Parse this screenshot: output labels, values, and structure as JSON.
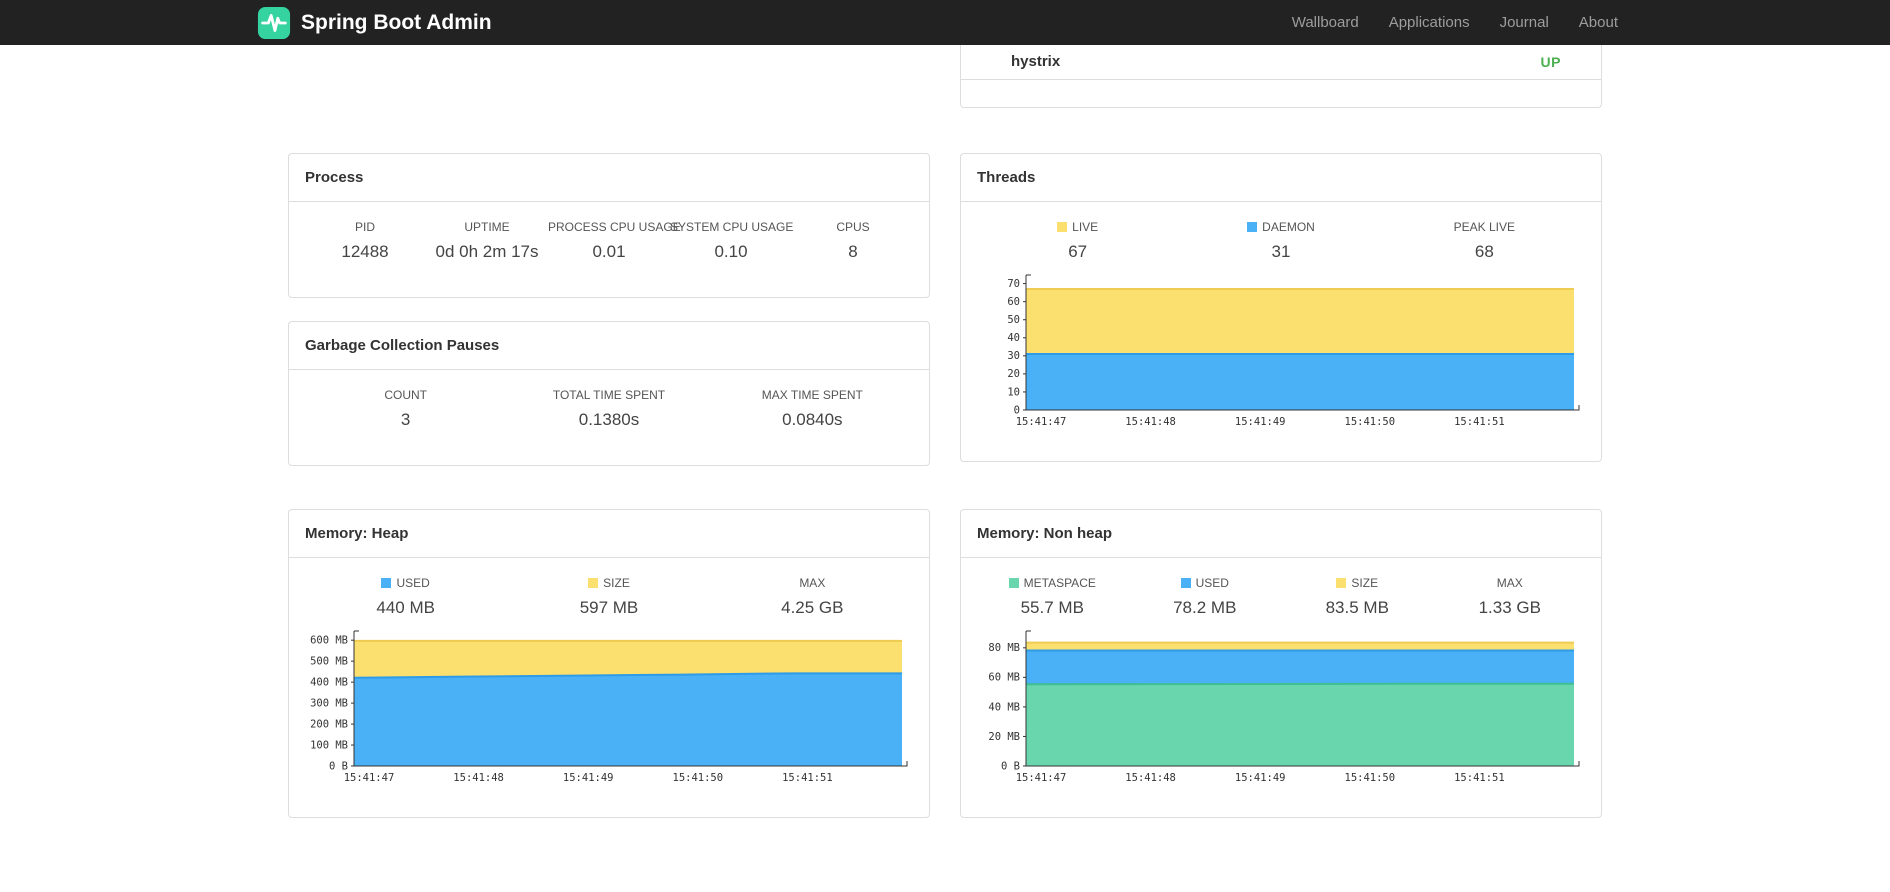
{
  "navbar": {
    "brand": "Spring Boot Admin",
    "links": [
      "Wallboard",
      "Applications",
      "Journal",
      "About"
    ]
  },
  "status_panel": {
    "application": "hystrix",
    "status": "UP",
    "status_color": "#4CAF50"
  },
  "panels": {
    "process": {
      "title": "Process",
      "metrics": [
        {
          "label": "PID",
          "value": "12488"
        },
        {
          "label": "UPTIME",
          "value": "0d 0h 2m 17s"
        },
        {
          "label": "PROCESS CPU USAGE",
          "value": "0.01"
        },
        {
          "label": "SYSTEM CPU USAGE",
          "value": "0.10"
        },
        {
          "label": "CPUS",
          "value": "8"
        }
      ]
    },
    "gc": {
      "title": "Garbage Collection Pauses",
      "metrics": [
        {
          "label": "COUNT",
          "value": "3"
        },
        {
          "label": "TOTAL TIME SPENT",
          "value": "0.1380s"
        },
        {
          "label": "MAX TIME SPENT",
          "value": "0.0840s"
        }
      ]
    },
    "threads": {
      "title": "Threads",
      "legend": [
        {
          "label": "LIVE",
          "value": "67",
          "color": "#FBDF6F"
        },
        {
          "label": "DAEMON",
          "value": "31",
          "color": "#4AB1F6"
        },
        {
          "label": "PEAK LIVE",
          "value": "68"
        }
      ]
    },
    "heap": {
      "title": "Memory: Heap",
      "legend": [
        {
          "label": "USED",
          "value": "440 MB",
          "color": "#4AB1F6"
        },
        {
          "label": "SIZE",
          "value": "597 MB",
          "color": "#FBDF6F"
        },
        {
          "label": "MAX",
          "value": "4.25 GB"
        }
      ]
    },
    "nonheap": {
      "title": "Memory: Non heap",
      "legend": [
        {
          "label": "METASPACE",
          "value": "55.7 MB",
          "color": "#69D6AD"
        },
        {
          "label": "USED",
          "value": "78.2 MB",
          "color": "#4AB1F6"
        },
        {
          "label": "SIZE",
          "value": "83.5 MB",
          "color": "#FBDF6F"
        },
        {
          "label": "MAX",
          "value": "1.33 GB"
        }
      ]
    }
  },
  "chart_data": [
    {
      "id": "threads",
      "type": "area",
      "title": "Threads",
      "xlabel": "",
      "ylabel": "",
      "legend_position": "top",
      "x": [
        "15:41:47",
        "15:41:48",
        "15:41:49",
        "15:41:50",
        "15:41:51"
      ],
      "ymax": 72,
      "yticks": [
        {
          "v": 0,
          "label": "0"
        },
        {
          "v": 10,
          "label": "10"
        },
        {
          "v": 20,
          "label": "20"
        },
        {
          "v": 30,
          "label": "30"
        },
        {
          "v": 40,
          "label": "40"
        },
        {
          "v": 50,
          "label": "50"
        },
        {
          "v": 60,
          "label": "60"
        },
        {
          "v": 70,
          "label": "70"
        }
      ],
      "series": [
        {
          "name": "LIVE",
          "fill": "#FBDF6F",
          "line": "#EECB52",
          "values": [
            67,
            67,
            67,
            67,
            67
          ]
        },
        {
          "name": "DAEMON",
          "fill": "#4AB1F6",
          "line": "#2D9BE8",
          "values": [
            31,
            31,
            31,
            31,
            31
          ]
        }
      ]
    },
    {
      "id": "heap",
      "type": "area",
      "title": "Memory: Heap (MB)",
      "xlabel": "",
      "ylabel": "",
      "legend_position": "top",
      "x": [
        "15:41:47",
        "15:41:48",
        "15:41:49",
        "15:41:50",
        "15:41:51"
      ],
      "ymax": 620,
      "yticks": [
        {
          "v": 0,
          "label": "0 B"
        },
        {
          "v": 100,
          "label": "100 MB"
        },
        {
          "v": 200,
          "label": "200 MB"
        },
        {
          "v": 300,
          "label": "300 MB"
        },
        {
          "v": 400,
          "label": "400 MB"
        },
        {
          "v": 500,
          "label": "500 MB"
        },
        {
          "v": 600,
          "label": "600 MB"
        }
      ],
      "series": [
        {
          "name": "SIZE",
          "fill": "#FBDF6F",
          "line": "#EECB52",
          "values": [
            597,
            597,
            597,
            597,
            597
          ]
        },
        {
          "name": "USED",
          "fill": "#4AB1F6",
          "line": "#2D9BE8",
          "values": [
            421,
            426,
            431,
            436,
            442
          ]
        }
      ]
    },
    {
      "id": "nonheap",
      "type": "area",
      "title": "Memory: Non heap (MB)",
      "xlabel": "",
      "ylabel": "",
      "legend_position": "top",
      "x": [
        "15:41:47",
        "15:41:48",
        "15:41:49",
        "15:41:50",
        "15:41:51"
      ],
      "ymax": 88,
      "yticks": [
        {
          "v": 0,
          "label": "0 B"
        },
        {
          "v": 20,
          "label": "20 MB"
        },
        {
          "v": 40,
          "label": "40 MB"
        },
        {
          "v": 60,
          "label": "60 MB"
        },
        {
          "v": 80,
          "label": "80 MB"
        }
      ],
      "series": [
        {
          "name": "SIZE",
          "fill": "#FBDF6F",
          "line": "#EECB52",
          "values": [
            83.5,
            83.5,
            83.5,
            83.5,
            83.5
          ]
        },
        {
          "name": "USED",
          "fill": "#4AB1F6",
          "line": "#2D9BE8",
          "values": [
            78.2,
            78.2,
            78.2,
            78.2,
            78.2
          ]
        },
        {
          "name": "METASPACE",
          "fill": "#69D6AD",
          "line": "#3FBF92",
          "values": [
            55.3,
            55.4,
            55.5,
            55.6,
            55.7
          ]
        }
      ]
    }
  ]
}
